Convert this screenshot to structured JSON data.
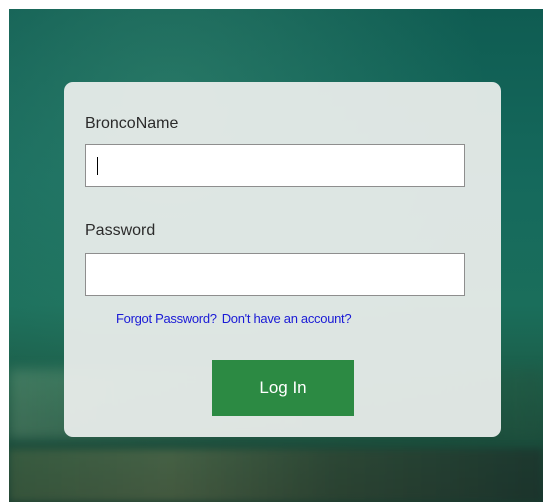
{
  "login_form": {
    "username_label": "BroncoName",
    "username_value": "",
    "password_label": "Password",
    "password_value": "",
    "forgot_password_link": "Forgot Password?",
    "create_account_link": "Don't have an account?",
    "login_button": "Log In"
  },
  "colors": {
    "login_button": "#2c8a43",
    "link": "#1a1ad6",
    "background": "#15695c"
  }
}
